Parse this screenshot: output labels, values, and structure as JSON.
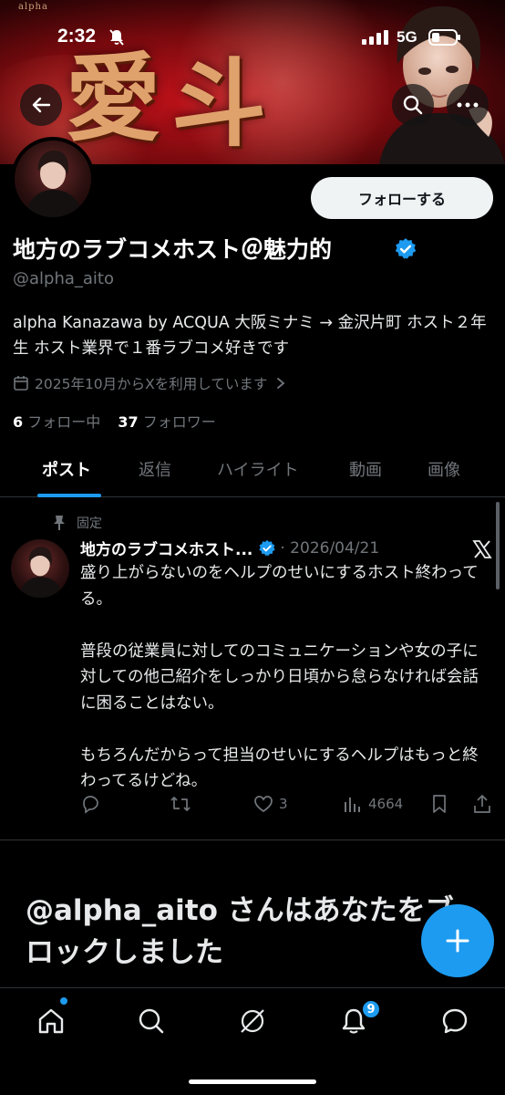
{
  "status_bar": {
    "time": "2:32",
    "network": "5G"
  },
  "banner": {
    "kanji": [
      "愛",
      "斗"
    ],
    "logo_text": "alpha"
  },
  "profile": {
    "display_name": "地方のラブコメホスト＠魅力的",
    "handle": "@alpha_aito",
    "bio": "alpha Kanazawa by ACQUA 大阪ミナミ → 金沢片町 ホスト２年生 ホスト業界で１番ラブコメ好きです",
    "joined": "2025年10月からXを利用しています",
    "following_count": "6",
    "following_label": "フォロー中",
    "followers_count": "37",
    "followers_label": "フォロワー",
    "follow_button": "フォローする"
  },
  "tabs": [
    {
      "label": "ポスト",
      "active": true
    },
    {
      "label": "返信",
      "active": false
    },
    {
      "label": "ハイライト",
      "active": false
    },
    {
      "label": "動画",
      "active": false
    },
    {
      "label": "画像",
      "active": false
    }
  ],
  "pinned_post": {
    "pinned_label": "固定",
    "author_name": "地方のラブコメホスト...",
    "date": "· 2026/04/21",
    "body": "盛り上がらないのをヘルプのせいにするホスト終わってる。\n\n普段の従業員に対してのコミュニケーションや女の子に対しての他己紹介をしっかり日頃から怠らなければ会話に困ることはない。\n\nもちろんだからって担当のせいにするヘルプはもっと終わってるけどね。",
    "likes": "3",
    "views": "4664"
  },
  "blocked_notice": "@alpha_aito さんはあなたをブロックしました",
  "bottom_nav": {
    "notification_badge": "9"
  },
  "colors": {
    "accent": "#1d9bf0",
    "background": "#000000",
    "muted": "#71767b"
  },
  "icons": [
    "back-arrow-icon",
    "search-icon",
    "more-icon",
    "verified-badge-icon",
    "calendar-icon",
    "chevron-right-icon",
    "pin-icon",
    "x-logo-icon",
    "reply-icon",
    "repost-icon",
    "like-icon",
    "views-icon",
    "bookmark-icon",
    "share-icon",
    "plus-icon",
    "home-icon",
    "explore-icon",
    "grok-icon",
    "bell-icon",
    "messages-icon"
  ]
}
